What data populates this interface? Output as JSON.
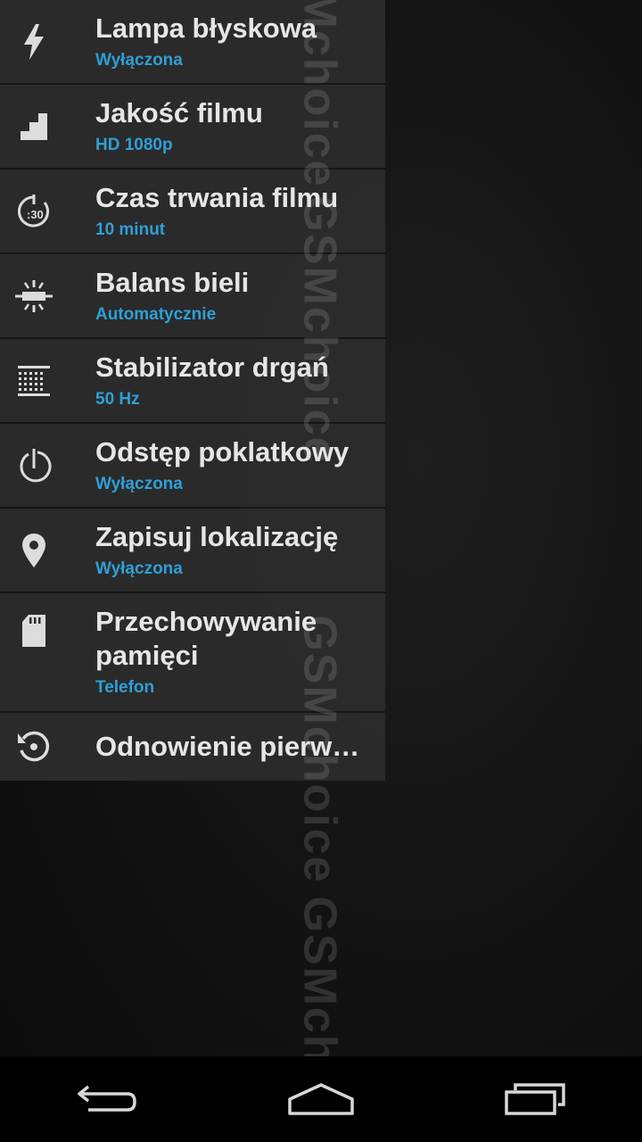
{
  "settings": {
    "items": [
      {
        "title": "Lampa błyskowa",
        "value": "Wyłączona",
        "icon": "flash-icon"
      },
      {
        "title": "Jakość filmu",
        "value": "HD 1080p",
        "icon": "quality-steps-icon"
      },
      {
        "title": "Czas trwania filmu",
        "value": "10 minut",
        "icon": "timer-30-icon"
      },
      {
        "title": "Balans bieli",
        "value": "Automatycznie",
        "icon": "white-balance-icon"
      },
      {
        "title": "Stabilizator drgań",
        "value": "50 Hz",
        "icon": "flicker-grid-icon"
      },
      {
        "title": "Odstęp poklatkowy",
        "value": "Wyłączona",
        "icon": "time-lapse-icon"
      },
      {
        "title": "Zapisuj lokalizację",
        "value": "Wyłączona",
        "icon": "location-pin-icon"
      },
      {
        "title": "Przechowywanie pamięci",
        "value": "Telefon",
        "icon": "sd-card-icon"
      },
      {
        "title": "Odnowienie pierwotnych ustawień",
        "icon": "restore-icon"
      }
    ]
  },
  "watermark": {
    "text": "GSMchoice"
  },
  "navbar": {
    "back_icon": "back-icon",
    "home_icon": "home-icon",
    "recents_icon": "recent-apps-icon"
  },
  "colors": {
    "accent": "#2f9fd6",
    "title_text": "#e6e6e6",
    "panel_bg": "#2c2c2c",
    "icon": "#dcdcdc"
  }
}
